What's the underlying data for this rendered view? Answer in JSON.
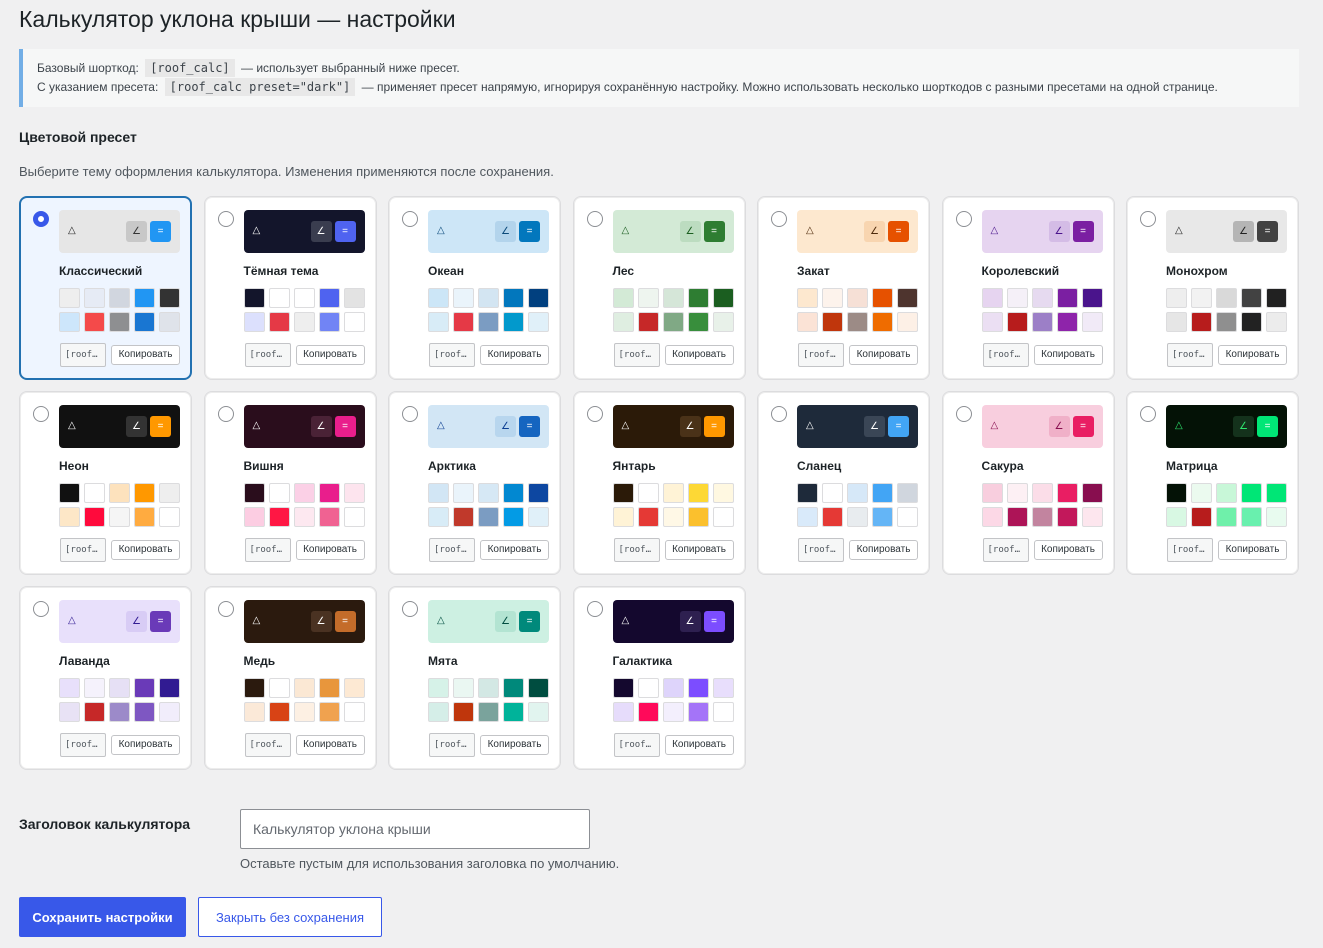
{
  "page": {
    "title": "Калькулятор уклона крыши — настройки"
  },
  "notice": {
    "line1_label": "Базовый шорткод:",
    "line1_code": "[roof_calc]",
    "line1_text": "— использует выбранный ниже пресет.",
    "line2_label": "С указанием пресета:",
    "line2_code": "[roof_calc preset=\"dark\"]",
    "line2_text": "— применяет пресет напрямую, игнорируя сохранённую настройку. Можно использовать несколько шорткодов с разными пресетами на одной странице."
  },
  "presets_section": {
    "title": "Цветовой пресет",
    "description": "Выберите тему оформления калькулятора. Изменения применяются после сохранения."
  },
  "icons": {
    "triangle": "triangle-icon",
    "angle": "angle-icon",
    "equals": "equals-icon"
  },
  "glyphs": {
    "triangle": "△",
    "angle": "∠",
    "equals": "="
  },
  "presets": [
    {
      "name": "Классический",
      "shortcode": "[roof…",
      "copy_label": "Копировать",
      "selected": true,
      "preview": {
        "bg": "#e6e6e6",
        "tri": "#222222",
        "b1": "#c8c8c8",
        "b1t": "#333333",
        "b2": "#2196f3",
        "b2t": "#ffffff"
      },
      "swatches": [
        "#eeeeee",
        "#e6ebf5",
        "#d1d6df",
        "#2196f3",
        "#333333",
        "#cde6fb",
        "#f44a4a",
        "#8e8f91",
        "#1976d2",
        "#dfe3ea"
      ]
    },
    {
      "name": "Тёмная тема",
      "shortcode": "[roof…",
      "copy_label": "Копировать",
      "selected": false,
      "preview": {
        "bg": "#13152b",
        "tri": "#ffffff",
        "b1": "#3a3d4f",
        "b1t": "#ffffff",
        "b2": "#4f63f0",
        "b2t": "#ffffff"
      },
      "swatches": [
        "#13152b",
        "#ffffff",
        "#ffffff",
        "#4f63f0",
        "#e3e3e3",
        "#dce0fd",
        "#e53946",
        "#eeeeee",
        "#7184f5",
        "#ffffff"
      ]
    },
    {
      "name": "Океан",
      "shortcode": "[roof…",
      "copy_label": "Копировать",
      "selected": false,
      "preview": {
        "bg": "#cde6f7",
        "tri": "#0b4a7a",
        "b1": "#b3d4ec",
        "b1t": "#0b4a7a",
        "b2": "#0277bd",
        "b2t": "#ffffff"
      },
      "swatches": [
        "#cce6f7",
        "#eaf4fb",
        "#d3e5f2",
        "#0277bd",
        "#01407f",
        "#d8ecf7",
        "#e53946",
        "#7b9cc2",
        "#0299cc",
        "#e0f0f9"
      ]
    },
    {
      "name": "Лес",
      "shortcode": "[roof…",
      "copy_label": "Копировать",
      "selected": false,
      "preview": {
        "bg": "#d3ead6",
        "tri": "#1b5e20",
        "b1": "#bcdcc0",
        "b1t": "#1b5e20",
        "b2": "#2e7d32",
        "b2t": "#ffffff"
      },
      "swatches": [
        "#d3ead6",
        "#eef5ef",
        "#d5e6d8",
        "#2e7d32",
        "#1b5e20",
        "#dfeee1",
        "#c62828",
        "#80a985",
        "#388e3c",
        "#e8f1e9"
      ]
    },
    {
      "name": "Закат",
      "shortcode": "[roof…",
      "copy_label": "Копировать",
      "selected": false,
      "preview": {
        "bg": "#fde8cf",
        "tri": "#4e2a0b",
        "b1": "#f8d5b0",
        "b1t": "#4e2a0b",
        "b2": "#e65100",
        "b2t": "#ffffff"
      },
      "swatches": [
        "#fde8cf",
        "#fdf3ec",
        "#f6e0d6",
        "#e65100",
        "#4e342e",
        "#fbe3d6",
        "#c0360c",
        "#9c8b86",
        "#ef6c00",
        "#fdf0e6"
      ]
    },
    {
      "name": "Королевский",
      "shortcode": "[roof…",
      "copy_label": "Копировать",
      "selected": false,
      "preview": {
        "bg": "#e6d4f0",
        "tri": "#4a148c",
        "b1": "#d4bce6",
        "b1t": "#4a148c",
        "b2": "#7b1fa2",
        "b2t": "#ffffff"
      },
      "swatches": [
        "#e6d4f0",
        "#f5f0f8",
        "#e6daf0",
        "#7b1fa2",
        "#4a148c",
        "#ebdff3",
        "#b71c1c",
        "#9c7fc7",
        "#8e24aa",
        "#f1eaf7"
      ]
    },
    {
      "name": "Монохром",
      "shortcode": "[roof…",
      "copy_label": "Копировать",
      "selected": false,
      "preview": {
        "bg": "#e8e8e8",
        "tri": "#222222",
        "b1": "#b5b5b5",
        "b1t": "#222222",
        "b2": "#424242",
        "b2t": "#ffffff"
      },
      "swatches": [
        "#eeeeee",
        "#f2f2f2",
        "#d9d9d9",
        "#424242",
        "#212121",
        "#e6e6e6",
        "#b71c1c",
        "#8f8f8f",
        "#222222",
        "#ececec"
      ]
    },
    {
      "name": "Неон",
      "shortcode": "[roof…",
      "copy_label": "Копировать",
      "selected": false,
      "preview": {
        "bg": "#111111",
        "tri": "#ffffff",
        "b1": "#333333",
        "b1t": "#ffffff",
        "b2": "#ff9800",
        "b2t": "#ffffff"
      },
      "swatches": [
        "#111111",
        "#ffffff",
        "#fde2bd",
        "#ff9800",
        "#eeeeee",
        "#fde7c7",
        "#ff0a3c",
        "#f5f5f5",
        "#ffab40",
        "#ffffff"
      ]
    },
    {
      "name": "Вишня",
      "shortcode": "[roof…",
      "copy_label": "Копировать",
      "selected": false,
      "preview": {
        "bg": "#2a0d1c",
        "tri": "#ffffff",
        "b1": "#4a2236",
        "b1t": "#ffffff",
        "b2": "#e91e8c",
        "b2t": "#ffffff"
      },
      "swatches": [
        "#2a0d1c",
        "#ffffff",
        "#fbd0e6",
        "#e91e8c",
        "#fde4ee",
        "#fccde2",
        "#ff1744",
        "#fde8f0",
        "#f06292",
        "#ffffff"
      ]
    },
    {
      "name": "Арктика",
      "shortcode": "[roof…",
      "copy_label": "Копировать",
      "selected": false,
      "preview": {
        "bg": "#d2e6f5",
        "tri": "#0b3d91",
        "b1": "#b8d6ee",
        "b1t": "#0b3d91",
        "b2": "#1565c0",
        "b2t": "#ffffff"
      },
      "swatches": [
        "#d2e6f5",
        "#eaf4fb",
        "#d6e8f5",
        "#0288d1",
        "#0d47a1",
        "#d8ecf7",
        "#c0392b",
        "#7b9cc2",
        "#039be5",
        "#e0f0f9"
      ]
    },
    {
      "name": "Янтарь",
      "shortcode": "[roof…",
      "copy_label": "Копировать",
      "selected": false,
      "preview": {
        "bg": "#2b1a08",
        "tri": "#ffffff",
        "b1": "#4a3218",
        "b1t": "#ffffff",
        "b2": "#ff9800",
        "b2t": "#ffffff"
      },
      "swatches": [
        "#2b1a08",
        "#ffffff",
        "#fff3d6",
        "#fdd835",
        "#fff8e1",
        "#fff3d6",
        "#e53935",
        "#fff8e6",
        "#fbc02d",
        "#ffffff"
      ]
    },
    {
      "name": "Сланец",
      "shortcode": "[roof…",
      "copy_label": "Копировать",
      "selected": false,
      "preview": {
        "bg": "#1e2a3a",
        "tri": "#ffffff",
        "b1": "#3a4656",
        "b1t": "#ffffff",
        "b2": "#42a5f5",
        "b2t": "#ffffff"
      },
      "swatches": [
        "#1e2a3a",
        "#ffffff",
        "#d6e8f8",
        "#42a5f5",
        "#d0d6de",
        "#d9eafa",
        "#e53935",
        "#e8ecef",
        "#64b5f6",
        "#ffffff"
      ]
    },
    {
      "name": "Сакура",
      "shortcode": "[roof…",
      "copy_label": "Копировать",
      "selected": false,
      "preview": {
        "bg": "#f8cede",
        "tri": "#880e4f",
        "b1": "#f0b0c8",
        "b1t": "#880e4f",
        "b2": "#e91e63",
        "b2t": "#ffffff"
      },
      "swatches": [
        "#f8cede",
        "#fdf0f4",
        "#fbdde8",
        "#e91e63",
        "#880e4f",
        "#fcd8e6",
        "#ad1457",
        "#c2849f",
        "#c2185b",
        "#fde6ee"
      ]
    },
    {
      "name": "Матрица",
      "shortcode": "[roof…",
      "copy_label": "Копировать",
      "selected": false,
      "preview": {
        "bg": "#041206",
        "tri": "#2ee66e",
        "b1": "#14321c",
        "b1t": "#2ee66e",
        "b2": "#00e676",
        "b2t": "#ffffff"
      },
      "swatches": [
        "#041206",
        "#ebfaef",
        "#c8f7d8",
        "#00e676",
        "#00e676",
        "#d8f8e3",
        "#b71c1c",
        "#6ff0aa",
        "#69f0ae",
        "#e8fbef"
      ]
    },
    {
      "name": "Лаванда",
      "shortcode": "[roof…",
      "copy_label": "Копировать",
      "selected": false,
      "preview": {
        "bg": "#e8e0fb",
        "tri": "#311b92",
        "b1": "#d8ccf5",
        "b1t": "#311b92",
        "b2": "#6a3ab8",
        "b2t": "#ffffff"
      },
      "swatches": [
        "#e8e0fb",
        "#f5f2fc",
        "#e6e0f5",
        "#6a3ab8",
        "#311b92",
        "#e8e2f5",
        "#c62828",
        "#9c8ac9",
        "#7e57c2",
        "#f1edfb"
      ]
    },
    {
      "name": "Медь",
      "shortcode": "[roof…",
      "copy_label": "Копировать",
      "selected": false,
      "preview": {
        "bg": "#2b1a0e",
        "tri": "#ffffff",
        "b1": "#4a3222",
        "b1t": "#ffffff",
        "b2": "#c46c2a",
        "b2t": "#ffffff"
      },
      "swatches": [
        "#2b1a0e",
        "#ffffff",
        "#fbe8d4",
        "#e8963c",
        "#fde9d3",
        "#fbe9d8",
        "#d84315",
        "#fdf0e3",
        "#f0a24f",
        "#ffffff"
      ]
    },
    {
      "name": "Мята",
      "shortcode": "[roof…",
      "copy_label": "Копировать",
      "selected": false,
      "preview": {
        "bg": "#cdf0e2",
        "tri": "#004d40",
        "b1": "#b3e4d2",
        "b1t": "#004d40",
        "b2": "#00897b",
        "b2t": "#ffffff"
      },
      "swatches": [
        "#d6f2e8",
        "#eaf7f2",
        "#d3e8e4",
        "#00897b",
        "#004d40",
        "#d5eee8",
        "#bf360c",
        "#7aa39c",
        "#00b39a",
        "#e1f4ef"
      ]
    },
    {
      "name": "Галактика",
      "shortcode": "[roof…",
      "copy_label": "Копировать",
      "selected": false,
      "preview": {
        "bg": "#14082e",
        "tri": "#ffffff",
        "b1": "#2e2050",
        "b1t": "#ffffff",
        "b2": "#7c4dff",
        "b2t": "#ffffff"
      },
      "swatches": [
        "#14082e",
        "#ffffff",
        "#ded4fb",
        "#7c4dff",
        "#e8defc",
        "#e6dcfb",
        "#ff0a5a",
        "#f3effd",
        "#a474f8",
        "#ffffff"
      ]
    }
  ],
  "title_setting": {
    "label": "Заголовок калькулятора",
    "placeholder": "Калькулятор уклона крыши",
    "value": "",
    "hint": "Оставьте пустым для использования заголовка по умолчанию."
  },
  "actions": {
    "save_label": "Сохранить настройки",
    "close_label": "Закрыть без сохранения"
  }
}
